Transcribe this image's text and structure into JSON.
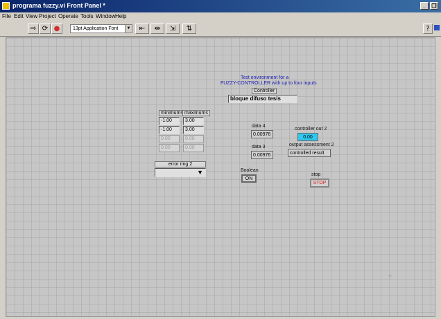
{
  "window": {
    "title": "programa fuzzy.vi Front Panel *"
  },
  "menu": [
    "File",
    "Edit",
    "View",
    "Project",
    "Operate",
    "Tools",
    "Window",
    "Help"
  ],
  "toolbar": {
    "font": "13pt Application Font"
  },
  "panel": {
    "heading_line1": "Test environment for a",
    "heading_line2": "FUZZY-CONTROLLER with up to four inputs",
    "controller_label": "Controller",
    "controller_value": "bloque difuso tesis",
    "minimums_label": "minimums",
    "maximums_label": "maximums",
    "minimums": [
      "-1.00",
      "-1.00",
      "0.00",
      "0.00"
    ],
    "maximums": [
      "3.00",
      "3.00",
      "0.00",
      "0.00"
    ],
    "error_ring_label": "error ring 2",
    "data4_label": "data 4",
    "data4_value": "0.00976",
    "data3_label": "data 3",
    "data3_value": "0.00976",
    "controller_out_label": "controller out 2",
    "controller_out_value": "0.00",
    "output_assessment_label": "output assessment 2",
    "output_assessment_value": "controlled result",
    "boolean_label": "Boolean",
    "boolean_value": "ON",
    "stop_label": "stop",
    "stop_button": "STOP"
  },
  "colors": {
    "titlebar": "#0a246a",
    "panel_bg": "#c6c6c6",
    "controller_out_bg": "#30c8f0",
    "stop_text": "#e02020"
  }
}
